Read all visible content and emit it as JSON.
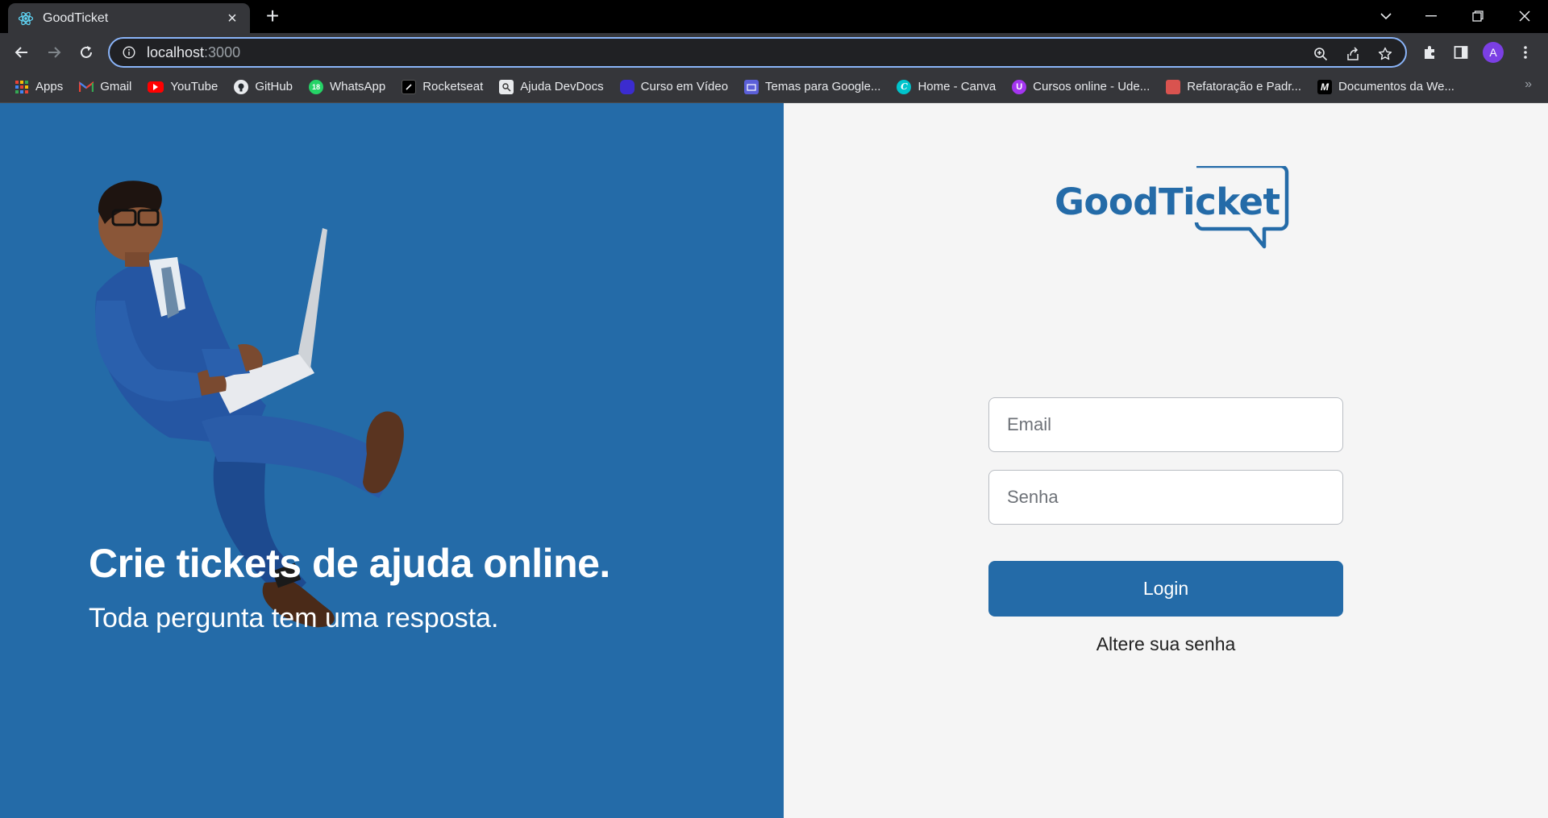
{
  "browser": {
    "tab_title": "GoodTicket",
    "url_host": "localhost",
    "url_port": ":3000",
    "profile_initial": "A",
    "accent_color": "#8ab4f8"
  },
  "bookmarks": [
    {
      "label": "Apps",
      "icon": "apps-grid-icon"
    },
    {
      "label": "Gmail",
      "icon": "gmail-icon"
    },
    {
      "label": "YouTube",
      "icon": "youtube-icon"
    },
    {
      "label": "GitHub",
      "icon": "github-icon"
    },
    {
      "label": "WhatsApp",
      "icon": "whatsapp-icon"
    },
    {
      "label": "Rocketseat",
      "icon": "rocketseat-icon"
    },
    {
      "label": "Ajuda DevDocs",
      "icon": "devdocs-icon"
    },
    {
      "label": "Curso em Vídeo",
      "icon": "cursoemvideo-icon"
    },
    {
      "label": "Temas para Google...",
      "icon": "themes-icon"
    },
    {
      "label": "Home - Canva",
      "icon": "canva-icon"
    },
    {
      "label": "Cursos online - Ude...",
      "icon": "udemy-icon"
    },
    {
      "label": "Refatoração e Padr...",
      "icon": "refactoring-icon"
    },
    {
      "label": "Documentos da We...",
      "icon": "mdn-icon"
    }
  ],
  "hero": {
    "headline": "Crie tickets de ajuda online.",
    "subline": "Toda pergunta tem uma resposta.",
    "background_color": "#246ba8"
  },
  "login": {
    "logo_text": "GoodTicket",
    "email_placeholder": "Email",
    "password_placeholder": "Senha",
    "submit_label": "Login",
    "forgot_label": "Altere sua senha",
    "brand_color": "#246ba8"
  }
}
